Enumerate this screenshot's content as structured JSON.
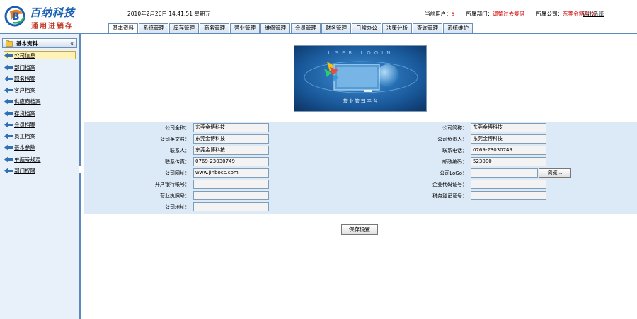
{
  "header": {
    "brand": "百纳科技",
    "subtitle": "通用进销存",
    "datetime": "2010年2月26日 14:41:51 星期五",
    "current_user_label": "当前用户：",
    "current_user": "a",
    "department_label": "所属部门：",
    "department": "调整过去筹借",
    "company_label": "所属公司：",
    "company": "东莞金博科技",
    "logout": "退出系统"
  },
  "tabs": [
    {
      "label": "基本资料",
      "active": true
    },
    {
      "label": "系统管理",
      "active": false
    },
    {
      "label": "库存管理",
      "active": false
    },
    {
      "label": "商务管理",
      "active": false
    },
    {
      "label": "营业管理",
      "active": false
    },
    {
      "label": "维修管理",
      "active": false
    },
    {
      "label": "会员管理",
      "active": false
    },
    {
      "label": "财务管理",
      "active": false
    },
    {
      "label": "日常办公",
      "active": false
    },
    {
      "label": "决策分析",
      "active": false
    },
    {
      "label": "查询管理",
      "active": false
    },
    {
      "label": "系统维护",
      "active": false
    }
  ],
  "sidebar": {
    "title": "基本资料",
    "collapse_glyph": "«",
    "items": [
      {
        "label": "公司信息",
        "active": true
      },
      {
        "label": "部门档案",
        "active": false
      },
      {
        "label": "职务档案",
        "active": false
      },
      {
        "label": "客户档案",
        "active": false
      },
      {
        "label": "供应商档案",
        "active": false
      },
      {
        "label": "存货档案",
        "active": false
      },
      {
        "label": "会员档案",
        "active": false
      },
      {
        "label": "员工档案",
        "active": false
      },
      {
        "label": "基本参数",
        "active": false
      },
      {
        "label": "单据号规定",
        "active": false
      },
      {
        "label": "部门权限",
        "active": false
      }
    ]
  },
  "banner": {
    "top_text": "USER LOGIN",
    "caption": "营业管理平台"
  },
  "form": {
    "left": [
      {
        "label": "公司全称：",
        "value": "东莞金博科技"
      },
      {
        "label": "公司英文名：",
        "value": "东莞金博科技"
      },
      {
        "label": "联系人：",
        "value": "东莞金博科技"
      },
      {
        "label": "联系传真：",
        "value": "0769-23030749"
      },
      {
        "label": "公司网址：",
        "value": "www.jinbocc.com"
      },
      {
        "label": "开户银行帐号：",
        "value": ""
      },
      {
        "label": "营业执照号：",
        "value": ""
      },
      {
        "label": "公司地址：",
        "value": ""
      }
    ],
    "right": [
      {
        "label": "公司简称：",
        "value": "东莞金博科技"
      },
      {
        "label": "公司负责人：",
        "value": "东莞金博科技"
      },
      {
        "label": "联系电话：",
        "value": "0769-23030749"
      },
      {
        "label": "邮政编码：",
        "value": "523000"
      },
      {
        "label": "公司LoGo：",
        "value": ""
      },
      {
        "label": "企业代码证号：",
        "value": ""
      },
      {
        "label": "税务登记证号：",
        "value": ""
      }
    ],
    "browse_label": "浏览...",
    "save_label": "保存设置"
  },
  "colors": {
    "accent": "#5b8ac0",
    "form_bg": "#dce9f6",
    "highlight": "#d00000",
    "active_nav": "#fff2b8"
  }
}
